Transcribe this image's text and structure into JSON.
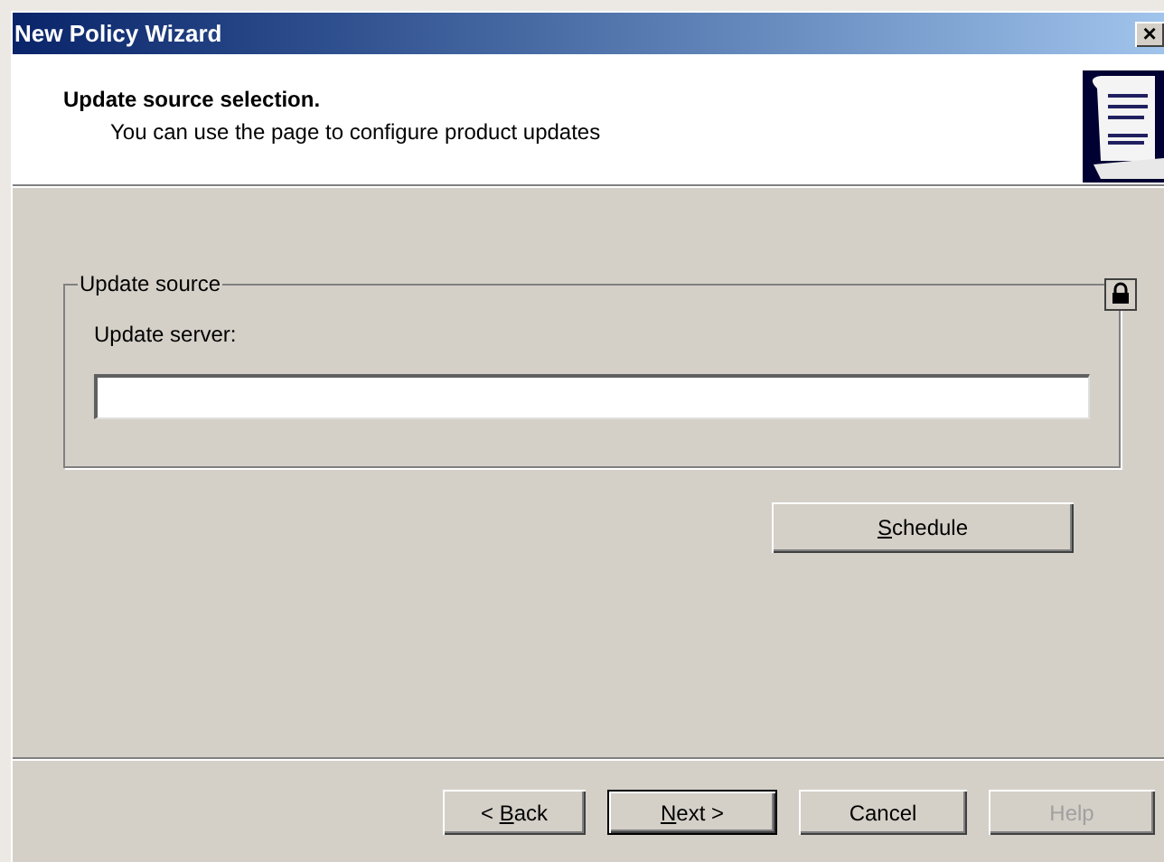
{
  "window": {
    "title": "New Policy Wizard",
    "close": "×"
  },
  "header": {
    "title": "Update source selection.",
    "subtitle": "You can use the page to configure product updates"
  },
  "group": {
    "title": "Update source",
    "locked": true,
    "field": {
      "label": "Update server:"
    }
  },
  "schedule_button": {
    "mnemonic": "S",
    "label_post": "chedule",
    "disabled": false,
    "default": false
  },
  "buttons": [
    {
      "label_pre": "< ",
      "mnemonic": "B",
      "label_post": "ack",
      "disabled": false,
      "default": false
    },
    {
      "mnemonic": "N",
      "label_post": "ext >",
      "disabled": false,
      "default": true
    },
    {
      "label_pre": "Cancel",
      "disabled": false,
      "default": false
    },
    {
      "label_pre": "Help",
      "disabled": true,
      "default": false
    }
  ]
}
